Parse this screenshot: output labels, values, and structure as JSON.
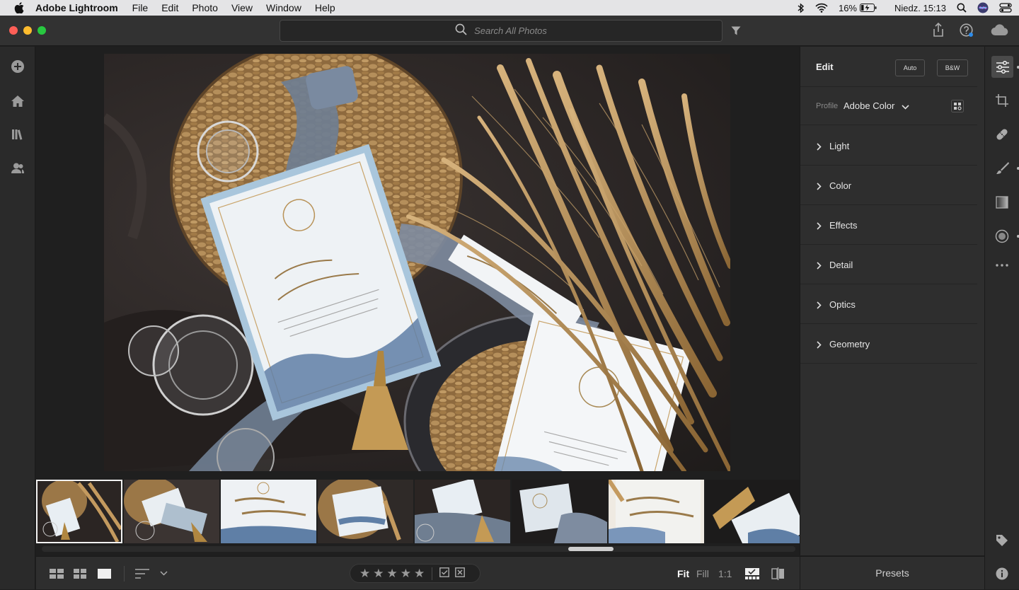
{
  "menubar": {
    "app_name": "Adobe Lightroom",
    "items": [
      "File",
      "Edit",
      "Photo",
      "View",
      "Window",
      "Help"
    ],
    "battery": "16%",
    "clock": "Niedz. 15:13"
  },
  "toolbar": {
    "search_placeholder": "Search All Photos"
  },
  "edit_panel": {
    "title": "Edit",
    "auto_label": "Auto",
    "bw_label": "B&W",
    "profile_label": "Profile",
    "profile_value": "Adobe Color",
    "sections": [
      "Light",
      "Color",
      "Effects",
      "Detail",
      "Optics",
      "Geometry"
    ]
  },
  "bottombar": {
    "zoom_fit": "Fit",
    "zoom_fill": "Fill",
    "zoom_1to1": "1:1",
    "stars": [
      "★",
      "★",
      "★",
      "★",
      "★"
    ]
  },
  "presets_label": "Presets",
  "filmstrip": {
    "selected_index": 0,
    "count": 8
  },
  "colors": {
    "accent": "#2d8ceb",
    "panel": "#2e2e2e",
    "background": "#1f1f1f"
  }
}
